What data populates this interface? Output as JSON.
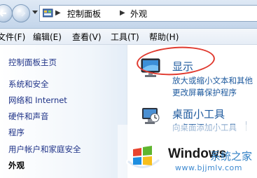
{
  "address": {
    "crumbs": [
      "控制面板",
      "外观"
    ],
    "separators": [
      "▶",
      "▶"
    ]
  },
  "menubar": {
    "items": [
      "文件(F)",
      "编辑(E)",
      "查看(V)",
      "工具(T)",
      "帮助(H)"
    ]
  },
  "sidebar": {
    "items": [
      {
        "label": "控制面板主页",
        "active": false
      },
      {
        "label": "系统和安全",
        "active": false
      },
      {
        "label": "网络和 Internet",
        "active": false
      },
      {
        "label": "硬件和声音",
        "active": false
      },
      {
        "label": "程序",
        "active": false
      },
      {
        "label": "用户帐户和家庭安全",
        "active": false
      },
      {
        "label": "外观",
        "active": true
      }
    ]
  },
  "main": {
    "categories": [
      {
        "title": "显示",
        "icon": "monitor-icon",
        "links": [
          "放大或缩小文本和其他",
          "更改屏幕保护程序"
        ]
      },
      {
        "title": "桌面小工具",
        "icon": "gadgets-icon",
        "links": [
          "向桌面添加小工具"
        ]
      }
    ]
  },
  "watermark": {
    "brand": "Windows",
    "site": "系统之家",
    "url": "www.bjjmlv.com"
  },
  "colors": {
    "link": "#1e5a9e",
    "highlight_oval": "#e03a2f",
    "toolbar": "#dfe9f5"
  }
}
